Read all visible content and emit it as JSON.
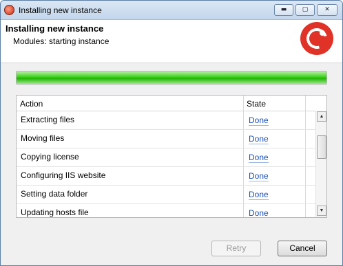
{
  "window": {
    "title": "Installing new instance",
    "controls": {
      "minimize": "▬",
      "maximize": "▢",
      "close": "✕"
    }
  },
  "header": {
    "title": "Installing new instance",
    "subtitle": "Modules: starting instance",
    "logo_icon": "app-logo-icon"
  },
  "progress": {
    "value_fraction": 1.0,
    "color": "#3bd11a"
  },
  "grid": {
    "columns": [
      "Action",
      "State"
    ],
    "rows": [
      {
        "action": "Extracting files",
        "state": "Done"
      },
      {
        "action": "Moving files",
        "state": "Done"
      },
      {
        "action": "Copying license",
        "state": "Done"
      },
      {
        "action": "Configuring IIS website",
        "state": "Done"
      },
      {
        "action": "Setting data folder",
        "state": "Done"
      },
      {
        "action": "Updating hosts file",
        "state": "Done"
      }
    ],
    "scroll_up": "▲",
    "scroll_down": "▼"
  },
  "buttons": {
    "retry": "Retry",
    "cancel": "Cancel"
  },
  "colors": {
    "accent_logo": "#e03226",
    "link": "#1a4fb4"
  }
}
